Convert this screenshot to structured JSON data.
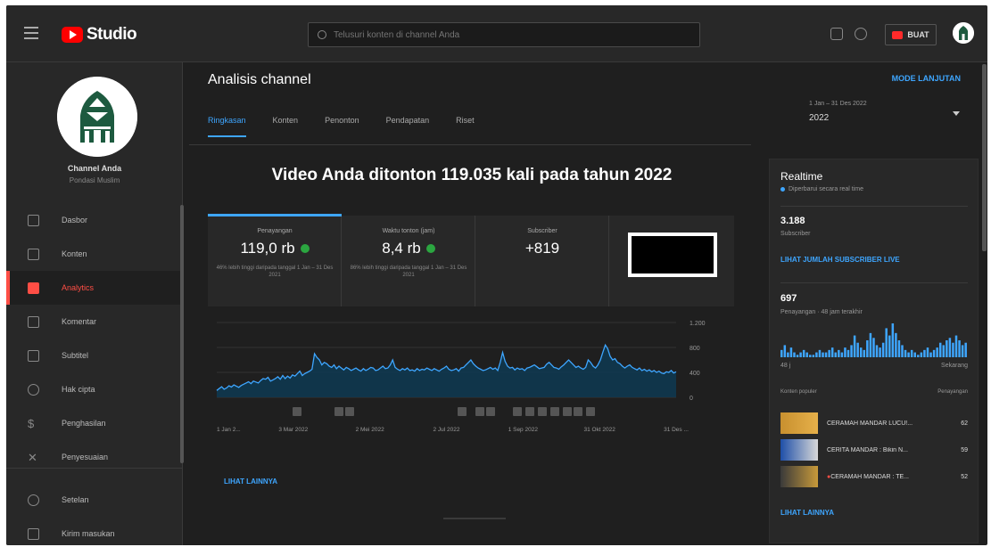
{
  "topbar": {
    "app_name": "Studio",
    "search_placeholder": "Telusuri konten di channel Anda",
    "create_label": "BUAT"
  },
  "sidebar": {
    "channel_name": "Channel Anda",
    "channel_sub": "Pondasi Muslim",
    "items": [
      {
        "label": "Dasbor",
        "icon": "dashboard-icon"
      },
      {
        "label": "Konten",
        "icon": "content-icon"
      },
      {
        "label": "Analytics",
        "icon": "analytics-icon",
        "active": true
      },
      {
        "label": "Komentar",
        "icon": "comments-icon"
      },
      {
        "label": "Subtitel",
        "icon": "subtitles-icon"
      },
      {
        "label": "Hak cipta",
        "icon": "copyright-icon"
      },
      {
        "label": "Penghasilan",
        "icon": "earn-icon"
      },
      {
        "label": "Penyesuaian",
        "icon": "customize-icon"
      }
    ],
    "bottom_items": [
      {
        "label": "Setelan",
        "icon": "settings-icon"
      },
      {
        "label": "Kirim masukan",
        "icon": "feedback-icon"
      }
    ]
  },
  "page": {
    "title": "Analisis channel",
    "advanced_mode": "MODE LANJUTAN",
    "date_range_label": "1 Jan – 31 Des 2022",
    "date_range_value": "2022",
    "tabs": [
      "Ringkasan",
      "Konten",
      "Penonton",
      "Pendapatan",
      "Riset"
    ],
    "active_tab": "Ringkasan"
  },
  "overview": {
    "headline": "Video Anda ditonton 119.035 kali pada tahun 2022",
    "metrics": [
      {
        "label": "Penayangan",
        "value": "119,0 rb",
        "note": "46% lebih tinggi daripada tanggal 1 Jan – 31 Des 2021"
      },
      {
        "label": "Waktu tonton (jam)",
        "value": "8,4 rb",
        "note": "86% lebih tinggi daripada tanggal 1 Jan – 31 Des 2021"
      },
      {
        "label": "Subscriber",
        "value": "+819",
        "note": ""
      }
    ],
    "see_more": "LIHAT LAINNYA"
  },
  "chart_data": {
    "type": "line",
    "x_ticks": [
      "1 Jan 2...",
      "3 Mar 2022",
      "2 Mei 2022",
      "2 Jul 2022",
      "1 Sep 2022",
      "31 Okt 2022",
      "31 Des ..."
    ],
    "y_ticks": [
      "1.200",
      "800",
      "400",
      "0"
    ],
    "ylim": [
      0,
      1200
    ],
    "series": [
      {
        "values": [
          110,
          140,
          170,
          130,
          150,
          185,
          165,
          200,
          180,
          160,
          190,
          210,
          230,
          250,
          220,
          260,
          245,
          230,
          270,
          300,
          290,
          320,
          260,
          280,
          300,
          330,
          290,
          350,
          300,
          340,
          310,
          360,
          340,
          380,
          420,
          350,
          380,
          400,
          420,
          450,
          700,
          640,
          600,
          520,
          560,
          540,
          500,
          480,
          520,
          460,
          500,
          470,
          440,
          480,
          460,
          430,
          450,
          470,
          440,
          420,
          460,
          430,
          450,
          480,
          470,
          430,
          440,
          470,
          500,
          460,
          470,
          520,
          600,
          480,
          450,
          430,
          460,
          440,
          470,
          430,
          440,
          420,
          460,
          430,
          450,
          440,
          470,
          450,
          430,
          460,
          440,
          420,
          450,
          470,
          500,
          450,
          430,
          440,
          460,
          420,
          470,
          480,
          520,
          560,
          600,
          540,
          500,
          470,
          450,
          430,
          440,
          460,
          480,
          450,
          470,
          430,
          560,
          720,
          580,
          500,
          470,
          480,
          440,
          470,
          450,
          460,
          430,
          470,
          480,
          500,
          520,
          490,
          460,
          470,
          480,
          530,
          560,
          520,
          480,
          470,
          450,
          490,
          520,
          560,
          600,
          560,
          520,
          480,
          500,
          470,
          450,
          480,
          600,
          560,
          500,
          470,
          520,
          600,
          720,
          840,
          780,
          660,
          600,
          620,
          560,
          540,
          500,
          470,
          500,
          520,
          480,
          460,
          440,
          470,
          430,
          450,
          420,
          440,
          410,
          430,
          400,
          420,
          390,
          380,
          410,
          400,
          430,
          390,
          410
        ]
      }
    ],
    "markers": [
      "A",
      "A",
      "A",
      "A",
      "A",
      "A",
      "A",
      "A",
      "A",
      "A",
      "A",
      "A",
      "A"
    ]
  },
  "realtime": {
    "title": "Realtime",
    "subtitle": "Diperbarui secara real time",
    "subscribers": "3.188",
    "subscribers_label": "Subscriber",
    "subscribers_link": "LIHAT JUMLAH SUBSCRIBER LIVE",
    "views": "697",
    "views_label": "Penayangan · 48 jam terakhir",
    "axis_left": "48 j",
    "axis_right": "Sekarang",
    "bars": [
      3,
      5,
      2,
      4,
      2,
      1,
      2,
      3,
      2,
      1,
      1,
      2,
      3,
      2,
      2,
      3,
      4,
      2,
      3,
      2,
      4,
      3,
      5,
      9,
      6,
      4,
      3,
      7,
      10,
      8,
      5,
      4,
      6,
      12,
      9,
      14,
      10,
      7,
      5,
      3,
      2,
      3,
      2,
      1,
      2,
      3,
      4,
      2,
      3,
      4,
      6,
      5,
      7,
      8,
      6,
      9,
      7,
      5,
      6
    ],
    "popular_label": "Konten populer",
    "popular_col": "Penayangan",
    "popular": [
      {
        "title": "CERAMAH MANDAR LUCU!...",
        "views": "62"
      },
      {
        "title": "CERITA MANDAR : Bikin N...",
        "views": "59"
      },
      {
        "title": "CERAMAH MANDAR : TE...",
        "views": "52"
      }
    ],
    "see_more": "LIHAT LAINNYA"
  }
}
